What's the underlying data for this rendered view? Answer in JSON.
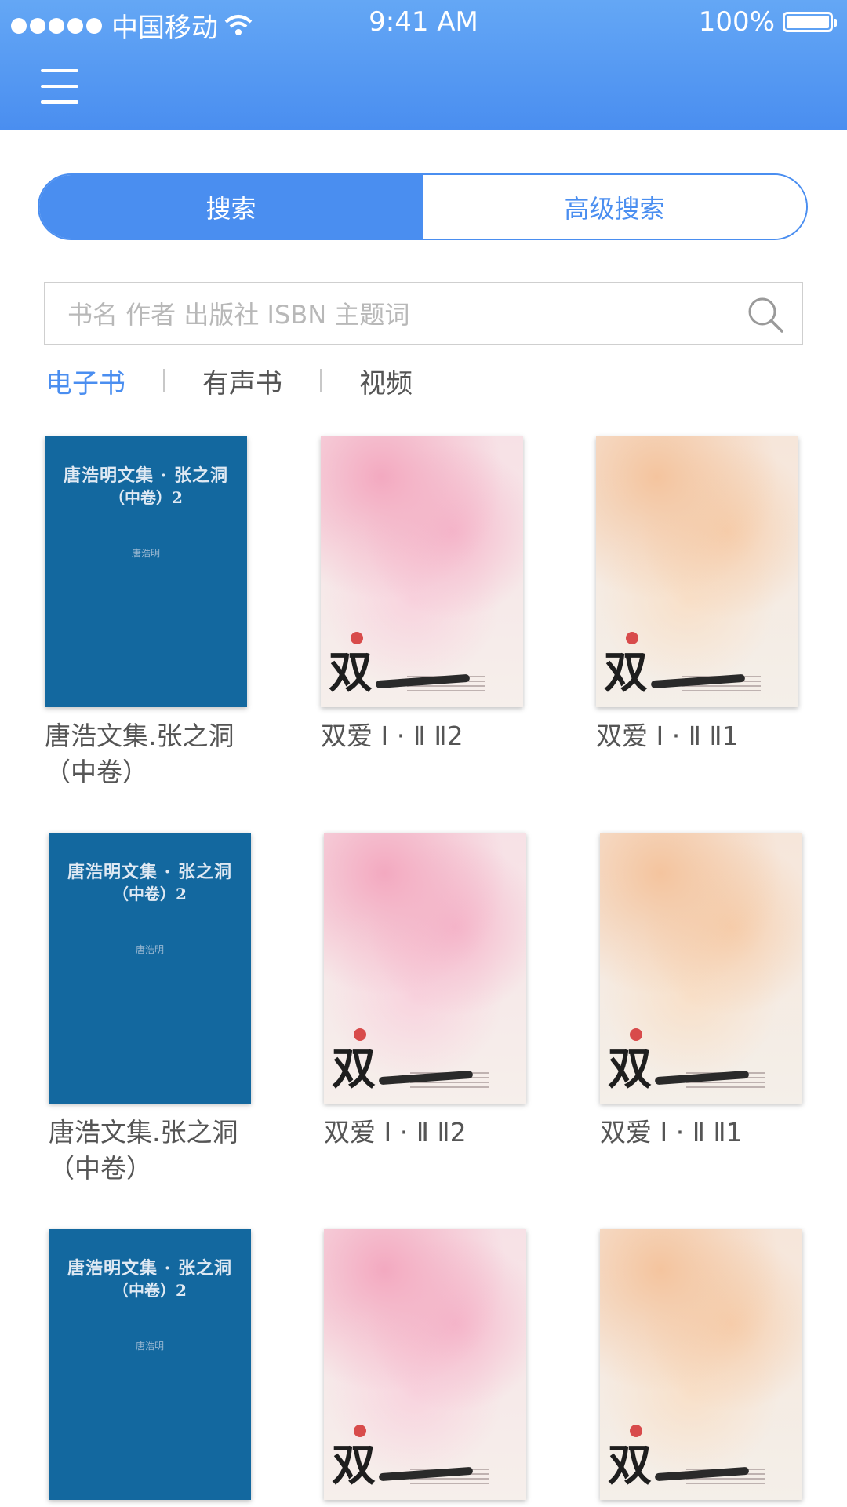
{
  "status_bar": {
    "carrier": "中国移动",
    "time": "9:41 AM",
    "battery": "100%"
  },
  "search_tabs": [
    {
      "label": "搜索",
      "active": true
    },
    {
      "label": "高级搜索",
      "active": false
    }
  ],
  "search": {
    "placeholder": "书名 作者 出版社 ISBN 主题词"
  },
  "categories": [
    {
      "label": "电子书",
      "active": true
    },
    {
      "label": "有声书",
      "active": false
    },
    {
      "label": "视频",
      "active": false
    }
  ],
  "colors": {
    "accent": "#4a8ef0",
    "header": "#5a9cf3",
    "blue_cover": "#13689f"
  },
  "books": [
    {
      "title": "唐浩文集.张之洞（中卷）",
      "cover": "blue",
      "cover_title": "唐浩明文集 · 张之洞",
      "cover_subtitle": "（中卷）2",
      "cover_author": "唐浩明"
    },
    {
      "title": "双爱 Ⅰ · Ⅱ Ⅱ2",
      "cover": "pink",
      "cover_glyph": "双"
    },
    {
      "title": "双爱 Ⅰ · Ⅱ Ⅱ1",
      "cover": "peach",
      "cover_glyph": "双"
    },
    {
      "title": "唐浩文集.张之洞（中卷）",
      "cover": "blue",
      "cover_title": "唐浩明文集 · 张之洞",
      "cover_subtitle": "（中卷）2",
      "cover_author": "唐浩明"
    },
    {
      "title": "双爱 Ⅰ · Ⅱ Ⅱ2",
      "cover": "pink",
      "cover_glyph": "双"
    },
    {
      "title": "双爱 Ⅰ · Ⅱ Ⅱ1",
      "cover": "peach",
      "cover_glyph": "双"
    },
    {
      "title": "",
      "cover": "blue",
      "cover_title": "唐浩明文集 · 张之洞",
      "cover_subtitle": "（中卷）2",
      "cover_author": "唐浩明"
    },
    {
      "title": "",
      "cover": "pink",
      "cover_glyph": "双"
    },
    {
      "title": "",
      "cover": "peach",
      "cover_glyph": "双"
    }
  ]
}
